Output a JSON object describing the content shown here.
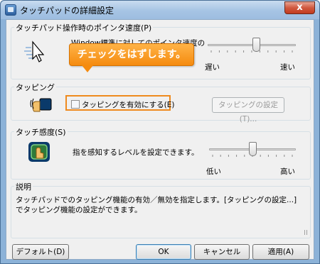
{
  "window": {
    "title": "タッチパッドの詳細設定",
    "close_glyph": "x"
  },
  "pointer_speed": {
    "group_label": "タッチパッド操作時のポインタ速度(P)",
    "description": "Window標準に対してのポインタ速度の調整ができます。",
    "slider_value": 0.56,
    "label_left": "遅い",
    "label_right": "速い",
    "icon": "pointer-speed-icon"
  },
  "tapping": {
    "group_label": "タッピング",
    "checkbox_label": "タッピングを有効にする(E)",
    "checked": false,
    "settings_button": "タッピングの設定(T)...",
    "icon": "tapping-icon"
  },
  "callout": {
    "text": "チェックをはずします。",
    "color": "#f58b0f"
  },
  "sensitivity": {
    "group_label": "タッチ感度(S)",
    "description": "指を感知するレベルを設定できます。",
    "slider_value": 0.5,
    "label_left": "低い",
    "label_right": "高い",
    "icon": "touch-sensitivity-icon"
  },
  "explanation": {
    "group_label": "説明",
    "text": "タッチパッドでのタッピング機能の有効／無効を指定します。[タッピングの設定...]でタッピング機能の設定ができます。"
  },
  "buttons": {
    "default": "デフォルト(D)",
    "ok": "OK",
    "cancel": "キャンセル",
    "apply": "適用(A)"
  }
}
